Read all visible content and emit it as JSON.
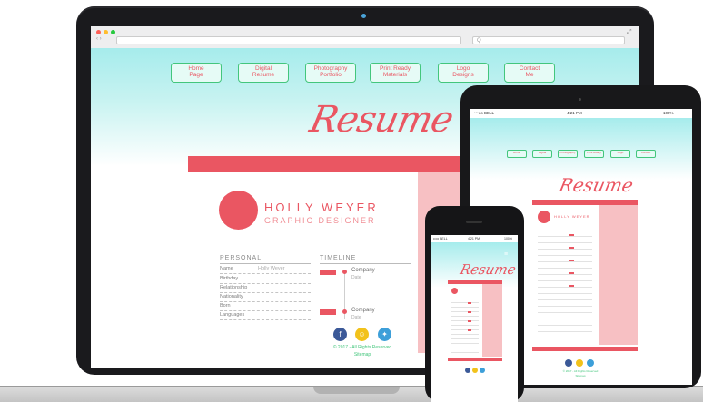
{
  "browser": {
    "url_placeholder": "",
    "search_placeholder": "Q"
  },
  "nav": [
    {
      "line1": "Home",
      "line2": "Page"
    },
    {
      "line1": "Digital",
      "line2": "Resume"
    },
    {
      "line1": "Photography",
      "line2": "Portfolio"
    },
    {
      "line1": "Print Ready",
      "line2": "Materials"
    },
    {
      "line1": "Logo",
      "line2": "Designs"
    },
    {
      "line1": "Contact",
      "line2": "Me"
    }
  ],
  "hero_title": "Resume",
  "profile": {
    "name": "HOLLY WEYER",
    "role": "GRAPHIC DESIGNER"
  },
  "personal": {
    "heading": "PERSONAL",
    "rows": [
      {
        "label": "Name",
        "value": "Holly Weyer"
      },
      {
        "label": "Birthday",
        "value": ""
      },
      {
        "label": "Relationship",
        "value": ""
      },
      {
        "label": "Nationality",
        "value": ""
      },
      {
        "label": "Born",
        "value": ""
      },
      {
        "label": "Languages",
        "value": ""
      }
    ]
  },
  "timeline": {
    "heading": "TIMELINE",
    "items": [
      {
        "company": "Company",
        "sub": "Date"
      },
      {
        "company": "Company",
        "sub": "Date"
      }
    ]
  },
  "footer": {
    "copyright": "© 2017 - All Rights Reserved",
    "sitemap": "Sitemap"
  },
  "tablet": {
    "carrier": "•••oo BELL",
    "time": "4:21 PM",
    "battery": "100%",
    "title": "Resume",
    "name": "HOLLY WEYER",
    "nav": [
      "Home",
      "Digital",
      "Photography",
      "Print Ready",
      "Logo",
      "Contact"
    ],
    "copyright": "© 2017 - All Rights Reserved",
    "sitemap": "Sitemap"
  },
  "phone": {
    "carrier": "••••• BELL",
    "time": "4:21 PM",
    "battery": "100%",
    "title": "Resume"
  },
  "colors": {
    "accent": "#ea5662",
    "green": "#43c67c",
    "sky": "#a6ecec",
    "pink": "#f7c0c3"
  }
}
